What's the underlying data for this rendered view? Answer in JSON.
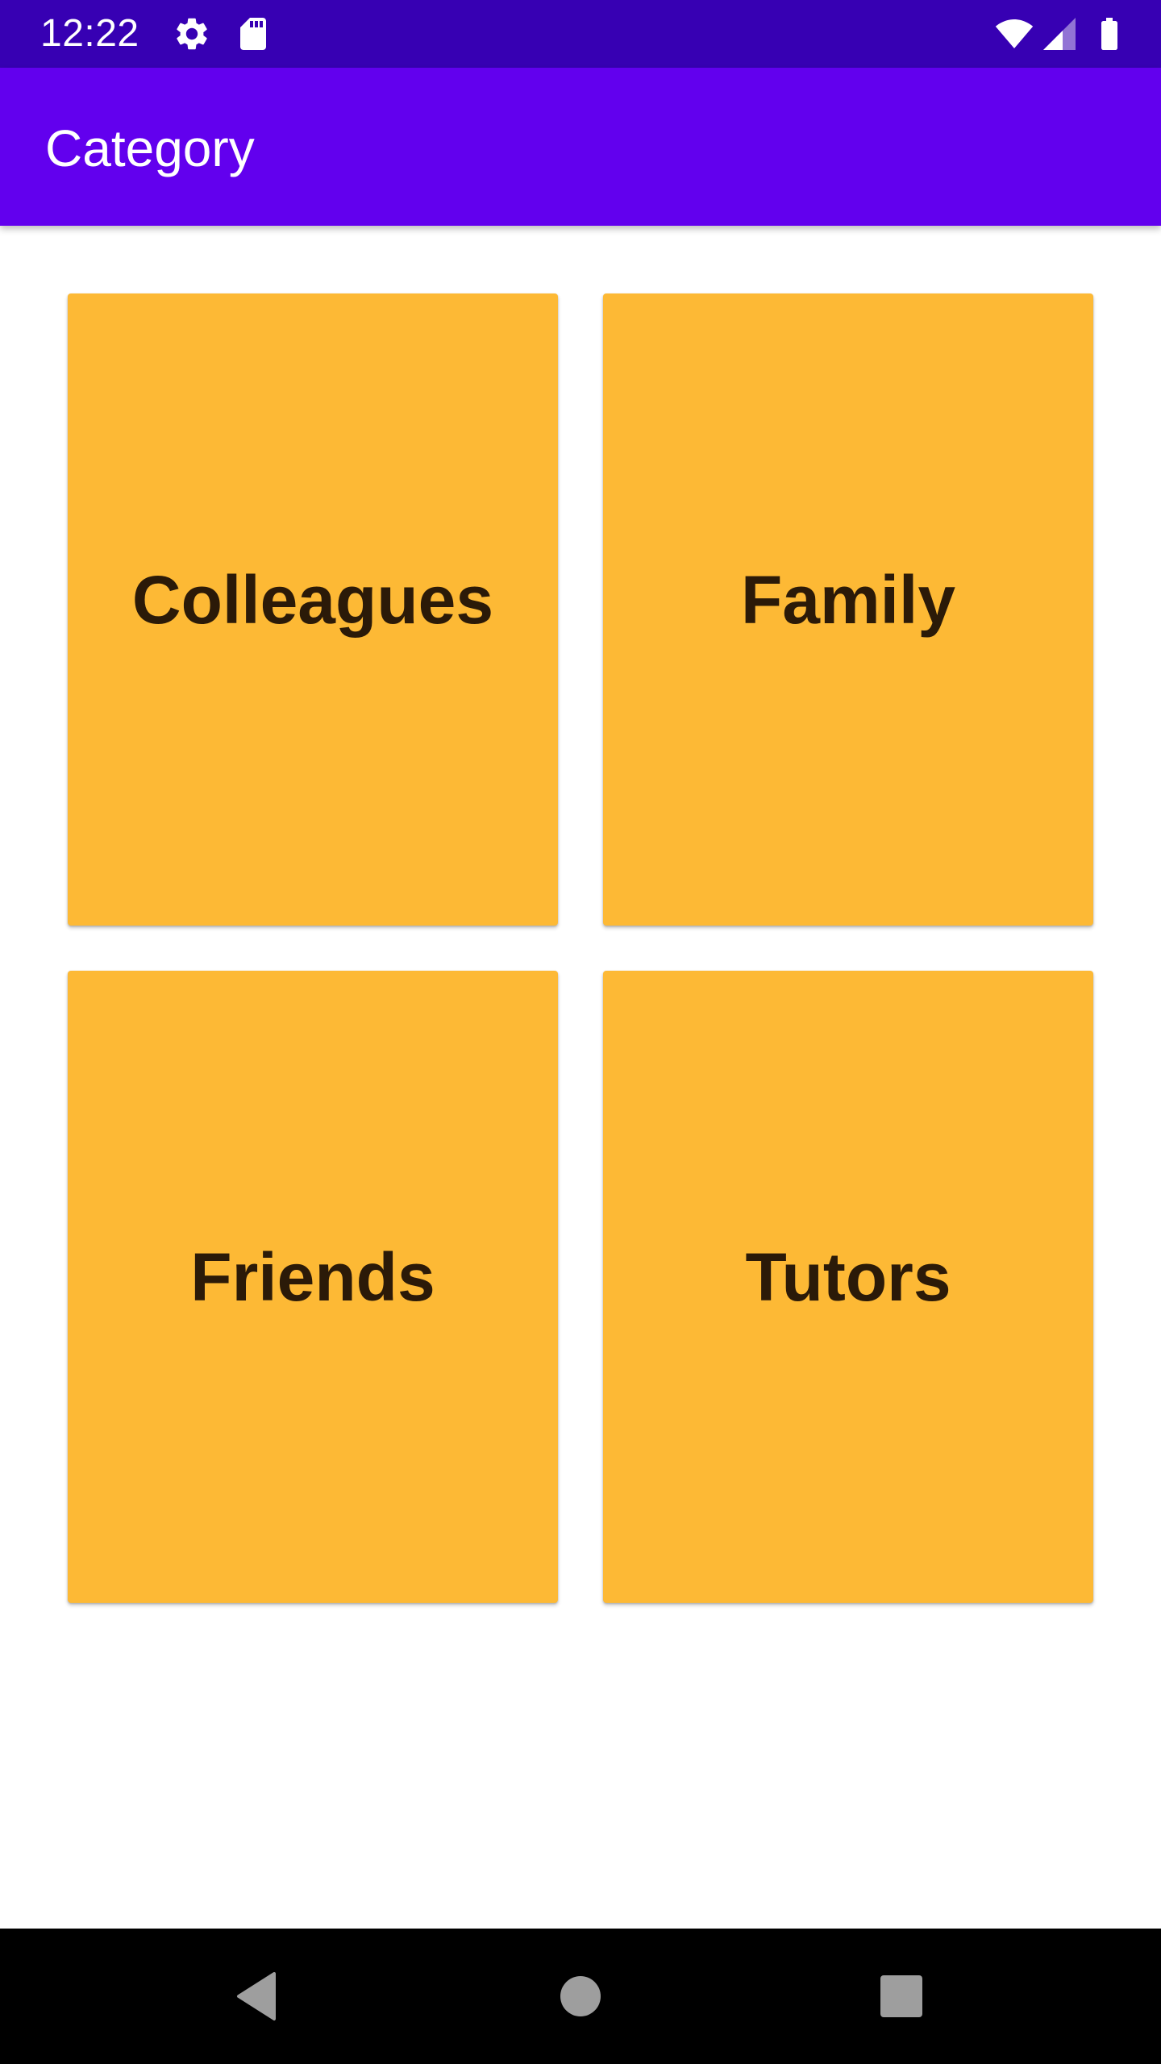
{
  "status_bar": {
    "time": "12:22",
    "icons": [
      "settings-icon",
      "sd-card-icon",
      "wifi-icon",
      "cellular-signal-icon",
      "battery-icon"
    ]
  },
  "app_bar": {
    "title": "Category"
  },
  "categories": [
    {
      "label": "Colleagues"
    },
    {
      "label": "Family"
    },
    {
      "label": "Friends"
    },
    {
      "label": "Tutors"
    }
  ],
  "nav_bar": {
    "buttons": [
      "back-icon",
      "home-icon",
      "recents-icon"
    ]
  },
  "colors": {
    "status_bar": "#3700b3",
    "app_bar": "#6200ee",
    "card": "#fdb935",
    "card_text": "#2b1a08",
    "nav_bar": "#000000"
  }
}
